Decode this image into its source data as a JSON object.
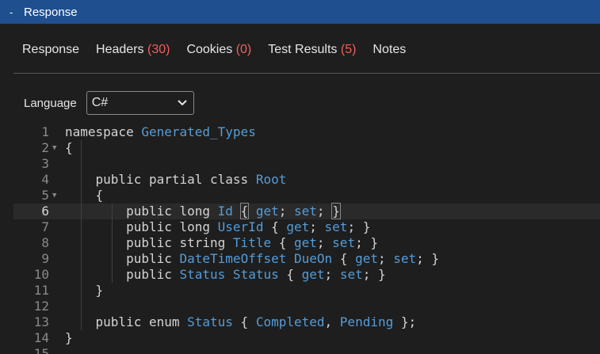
{
  "panel": {
    "title": "Response",
    "collapse_glyph": "-"
  },
  "tabs": [
    {
      "label": "Response",
      "count": ""
    },
    {
      "label": "Headers",
      "count": "(30)"
    },
    {
      "label": "Cookies",
      "count": "(0)"
    },
    {
      "label": "Test Results",
      "count": "(5)"
    },
    {
      "label": "Notes",
      "count": ""
    }
  ],
  "language": {
    "label": "Language",
    "selected": "C#"
  },
  "code_lines": [
    {
      "n": "1",
      "fold": false,
      "segs": [
        {
          "t": "namespace ",
          "k": 0
        },
        {
          "t": "Generated_Types",
          "k": 1
        }
      ]
    },
    {
      "n": "2",
      "fold": true,
      "segs": [
        {
          "t": "{",
          "k": 0
        }
      ]
    },
    {
      "n": "3",
      "fold": false,
      "segs": []
    },
    {
      "n": "4",
      "fold": false,
      "segs": [
        {
          "t": "    public partial class ",
          "k": 0
        },
        {
          "t": "Root",
          "k": 1
        }
      ]
    },
    {
      "n": "5",
      "fold": true,
      "segs": [
        {
          "t": "    {",
          "k": 0
        }
      ]
    },
    {
      "n": "6",
      "fold": false,
      "segs": [
        {
          "t": "        public long ",
          "k": 0
        },
        {
          "t": "Id",
          "k": 1
        },
        {
          "t": " ",
          "k": 0
        },
        {
          "t": "{",
          "k": 2
        },
        {
          "t": " ",
          "k": 0
        },
        {
          "t": "get",
          "k": 1
        },
        {
          "t": "; ",
          "k": 0
        },
        {
          "t": "set",
          "k": 1
        },
        {
          "t": "; ",
          "k": 0
        },
        {
          "t": "}",
          "k": 2
        }
      ]
    },
    {
      "n": "7",
      "fold": false,
      "segs": [
        {
          "t": "        public long ",
          "k": 0
        },
        {
          "t": "UserId",
          "k": 1
        },
        {
          "t": " { ",
          "k": 0
        },
        {
          "t": "get",
          "k": 1
        },
        {
          "t": "; ",
          "k": 0
        },
        {
          "t": "set",
          "k": 1
        },
        {
          "t": "; }",
          "k": 0
        }
      ]
    },
    {
      "n": "8",
      "fold": false,
      "segs": [
        {
          "t": "        public string ",
          "k": 0
        },
        {
          "t": "Title",
          "k": 1
        },
        {
          "t": " { ",
          "k": 0
        },
        {
          "t": "get",
          "k": 1
        },
        {
          "t": "; ",
          "k": 0
        },
        {
          "t": "set",
          "k": 1
        },
        {
          "t": "; }",
          "k": 0
        }
      ]
    },
    {
      "n": "9",
      "fold": false,
      "segs": [
        {
          "t": "        public ",
          "k": 0
        },
        {
          "t": "DateTimeOffset DueOn",
          "k": 1
        },
        {
          "t": " { ",
          "k": 0
        },
        {
          "t": "get",
          "k": 1
        },
        {
          "t": "; ",
          "k": 0
        },
        {
          "t": "set",
          "k": 1
        },
        {
          "t": "; }",
          "k": 0
        }
      ]
    },
    {
      "n": "10",
      "fold": false,
      "segs": [
        {
          "t": "        public ",
          "k": 0
        },
        {
          "t": "Status Status",
          "k": 1
        },
        {
          "t": " { ",
          "k": 0
        },
        {
          "t": "get",
          "k": 1
        },
        {
          "t": "; ",
          "k": 0
        },
        {
          "t": "set",
          "k": 1
        },
        {
          "t": "; }",
          "k": 0
        }
      ]
    },
    {
      "n": "11",
      "fold": false,
      "segs": [
        {
          "t": "    }",
          "k": 0
        }
      ]
    },
    {
      "n": "12",
      "fold": false,
      "segs": []
    },
    {
      "n": "13",
      "fold": false,
      "segs": [
        {
          "t": "    public enum ",
          "k": 0
        },
        {
          "t": "Status",
          "k": 1
        },
        {
          "t": " { ",
          "k": 0
        },
        {
          "t": "Completed",
          "k": 1
        },
        {
          "t": ", ",
          "k": 0
        },
        {
          "t": "Pending",
          "k": 1
        },
        {
          "t": " };",
          "k": 0
        }
      ]
    },
    {
      "n": "14",
      "fold": false,
      "segs": [
        {
          "t": "}",
          "k": 0
        }
      ]
    },
    {
      "n": "15",
      "fold": false,
      "segs": []
    }
  ],
  "active_line": "6",
  "colors": {
    "title_bar": "#1f4f8f",
    "count": "#f0605a",
    "type": "#569cd6",
    "plain": "#d4d4d4"
  },
  "icons": {
    "collapse": "minus-icon",
    "dropdown": "chevron-down-icon",
    "fold": "fold-triangle-icon"
  }
}
